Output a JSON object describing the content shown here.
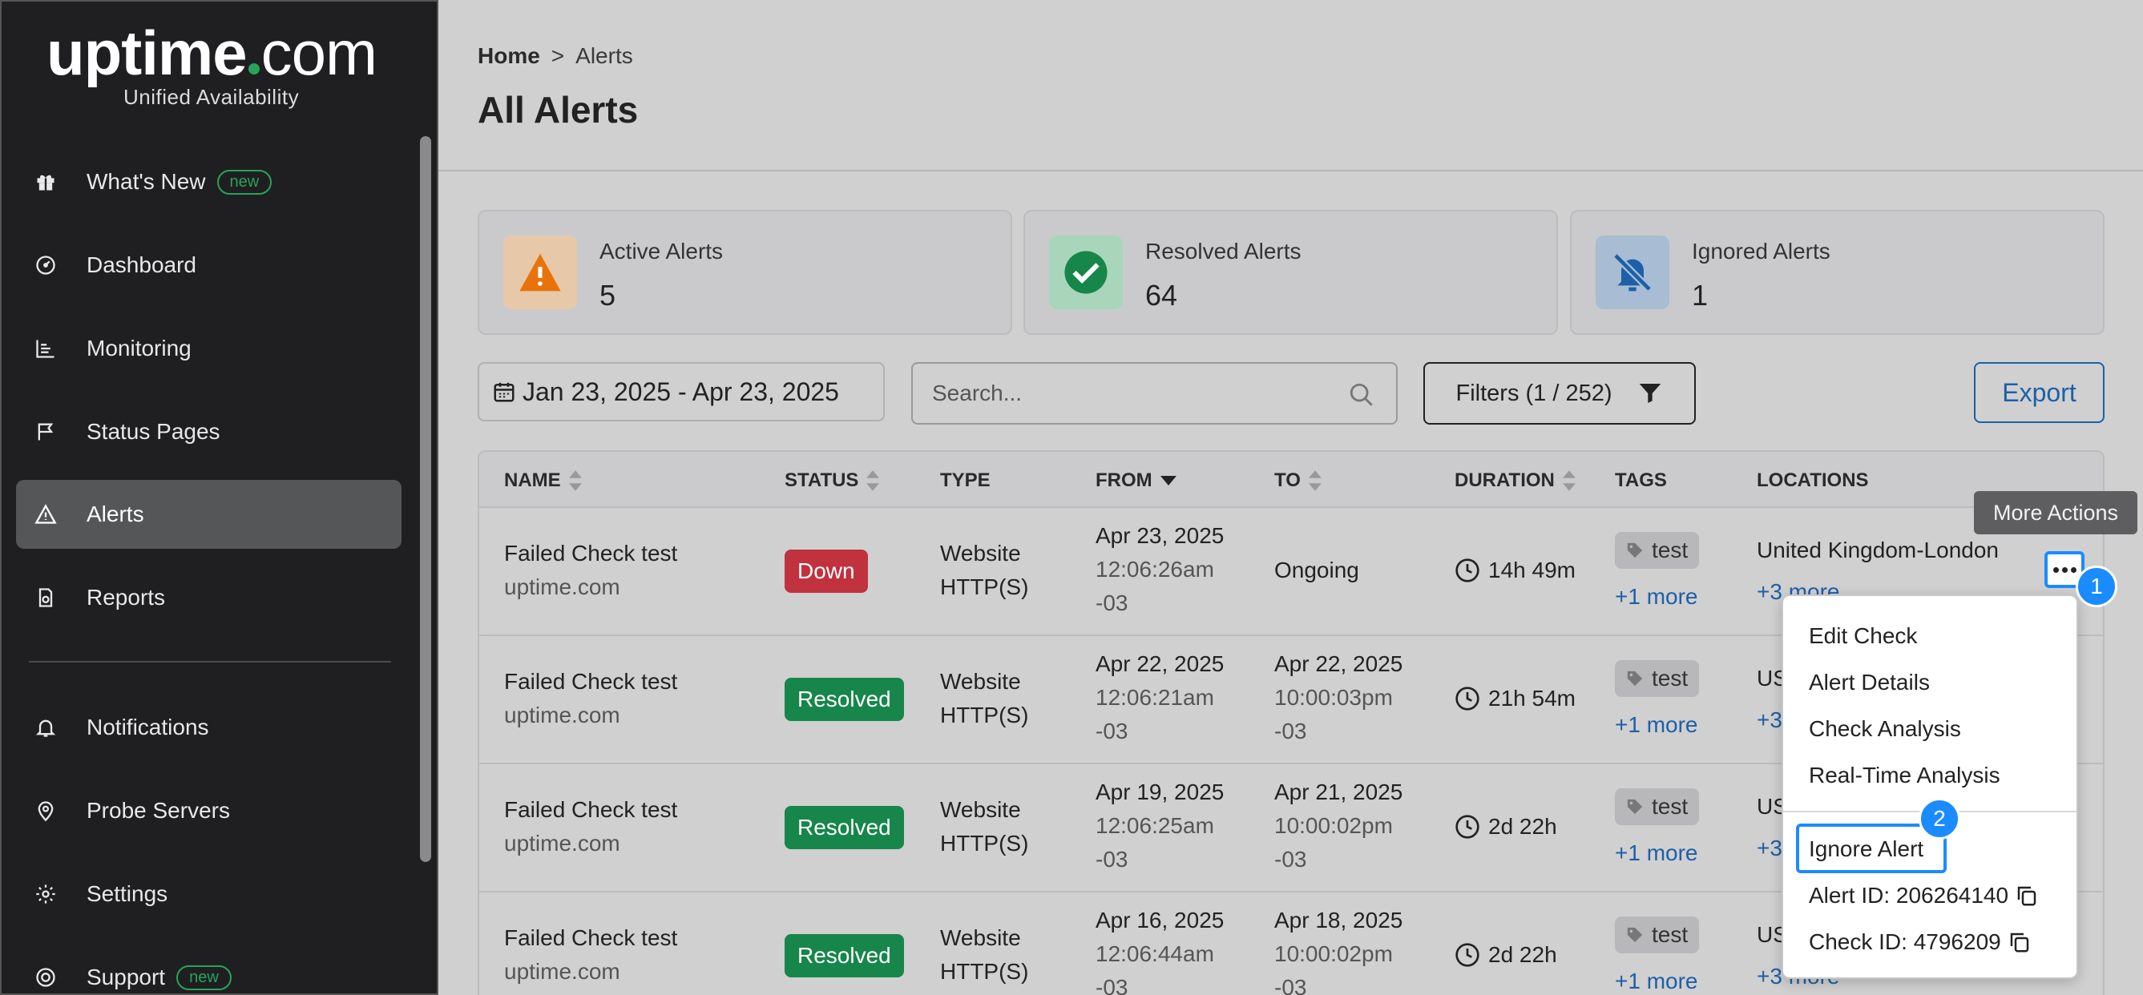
{
  "brand": {
    "name_left": "uptime",
    "name_right": "com",
    "tagline": "Unified Availability"
  },
  "sidebar": {
    "items": [
      {
        "label": "What's New",
        "badge": "new",
        "icon": "gift-icon"
      },
      {
        "label": "Dashboard",
        "icon": "gauge-icon"
      },
      {
        "label": "Monitoring",
        "icon": "chart-icon"
      },
      {
        "label": "Status Pages",
        "icon": "flag-icon"
      },
      {
        "label": "Alerts",
        "icon": "warning-icon",
        "active": true
      },
      {
        "label": "Reports",
        "icon": "report-icon"
      },
      {
        "label": "Notifications",
        "icon": "bell-icon"
      },
      {
        "label": "Probe Servers",
        "icon": "location-pin-icon"
      },
      {
        "label": "Settings",
        "icon": "gear-icon"
      },
      {
        "label": "Support",
        "badge": "new",
        "icon": "lifebuoy-icon"
      }
    ]
  },
  "breadcrumb": {
    "home": "Home",
    "sep": ">",
    "current": "Alerts"
  },
  "page_title": "All Alerts",
  "cards": [
    {
      "label": "Active Alerts",
      "value": "5",
      "color": "#e8730c"
    },
    {
      "label": "Resolved Alerts",
      "value": "64",
      "color": "#17864a"
    },
    {
      "label": "Ignored Alerts",
      "value": "1",
      "color": "#1d5fa8"
    }
  ],
  "toolbar": {
    "date_range": "Jan 23, 2025 - Apr 23, 2025",
    "search_placeholder": "Search...",
    "filters_label": "Filters (1 / 252)",
    "export_label": "Export"
  },
  "table": {
    "headers": [
      "NAME",
      "STATUS",
      "TYPE",
      "FROM",
      "TO",
      "DURATION",
      "TAGS",
      "LOCATIONS"
    ],
    "rows": [
      {
        "name": "Failed Check test",
        "domain": "uptime.com",
        "status": "Down",
        "type1": "Website",
        "type2": "HTTP(S)",
        "from_date": "Apr 23, 2025",
        "from_time": "12:06:26am",
        "from_tz": "-03",
        "to_date": "Ongoing",
        "to_time": "",
        "to_tz": "",
        "duration": "14h 49m",
        "tag": "test",
        "tag_more": "+1 more",
        "location": "United Kingdom-London",
        "loc_more": "+3 more"
      },
      {
        "name": "Failed Check test",
        "domain": "uptime.com",
        "status": "Resolved",
        "type1": "Website",
        "type2": "HTTP(S)",
        "from_date": "Apr 22, 2025",
        "from_time": "12:06:21am",
        "from_tz": "-03",
        "to_date": "Apr 22, 2025",
        "to_time": "10:00:03pm",
        "to_tz": "-03",
        "duration": "21h 54m",
        "tag": "test",
        "tag_more": "+1 more",
        "location": "US",
        "loc_more": "+3"
      },
      {
        "name": "Failed Check test",
        "domain": "uptime.com",
        "status": "Resolved",
        "type1": "Website",
        "type2": "HTTP(S)",
        "from_date": "Apr 19, 2025",
        "from_time": "12:06:25am",
        "from_tz": "-03",
        "to_date": "Apr 21, 2025",
        "to_time": "10:00:02pm",
        "to_tz": "-03",
        "duration": "2d 22h",
        "tag": "test",
        "tag_more": "+1 more",
        "location": "US",
        "loc_more": "+3"
      },
      {
        "name": "Failed Check test",
        "domain": "uptime.com",
        "status": "Resolved",
        "type1": "Website",
        "type2": "HTTP(S)",
        "from_date": "Apr 16, 2025",
        "from_time": "12:06:44am",
        "from_tz": "-03",
        "to_date": "Apr 18, 2025",
        "to_time": "10:00:02pm",
        "to_tz": "-03",
        "duration": "2d 22h",
        "tag": "test",
        "tag_more": "+1 more",
        "location": "US",
        "loc_more": "+3 more"
      }
    ]
  },
  "tooltip": "More Actions",
  "menu": {
    "items": [
      "Edit Check",
      "Alert Details",
      "Check Analysis",
      "Real-Time Analysis"
    ],
    "ignore": "Ignore Alert",
    "alert_id": "Alert ID: 206264140",
    "check_id": "Check ID: 4796209"
  },
  "steps": [
    "1",
    "2"
  ]
}
